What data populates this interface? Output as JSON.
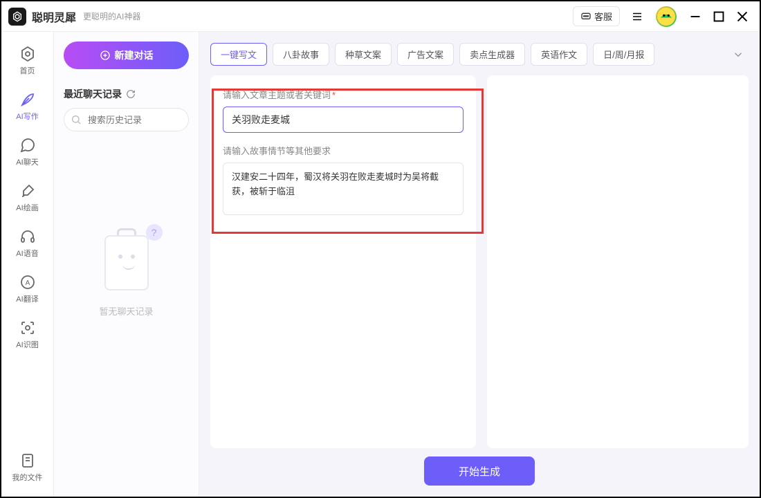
{
  "header": {
    "app_name": "聪明灵犀",
    "subtitle": "更聪明的AI神器",
    "customer_service": "客服"
  },
  "nav": {
    "items": [
      {
        "label": "首页"
      },
      {
        "label": "AI写作"
      },
      {
        "label": "AI聊天"
      },
      {
        "label": "AI绘画"
      },
      {
        "label": "AI语音"
      },
      {
        "label": "AI翻译"
      },
      {
        "label": "AI识图"
      }
    ],
    "bottom": {
      "label": "我的文件"
    }
  },
  "mid": {
    "new_chat": "新建对话",
    "recent_title": "最近聊天记录",
    "search_placeholder": "搜索历史记录",
    "empty_text": "暂无聊天记录"
  },
  "chips": [
    {
      "label": "一键写文"
    },
    {
      "label": "八卦故事"
    },
    {
      "label": "种草文案"
    },
    {
      "label": "广告文案"
    },
    {
      "label": "卖点生成器"
    },
    {
      "label": "英语作文"
    },
    {
      "label": "日/周/月报"
    }
  ],
  "form": {
    "topic_label": "请输入文章主题或者关键词",
    "topic_value": "关羽败走麦城",
    "detail_label": "请输入故事情节等其他要求",
    "detail_value": "汉建安二十四年，蜀汉将关羽在败走麦城时为吴将截获，被斩于临沮",
    "generate": "开始生成"
  }
}
